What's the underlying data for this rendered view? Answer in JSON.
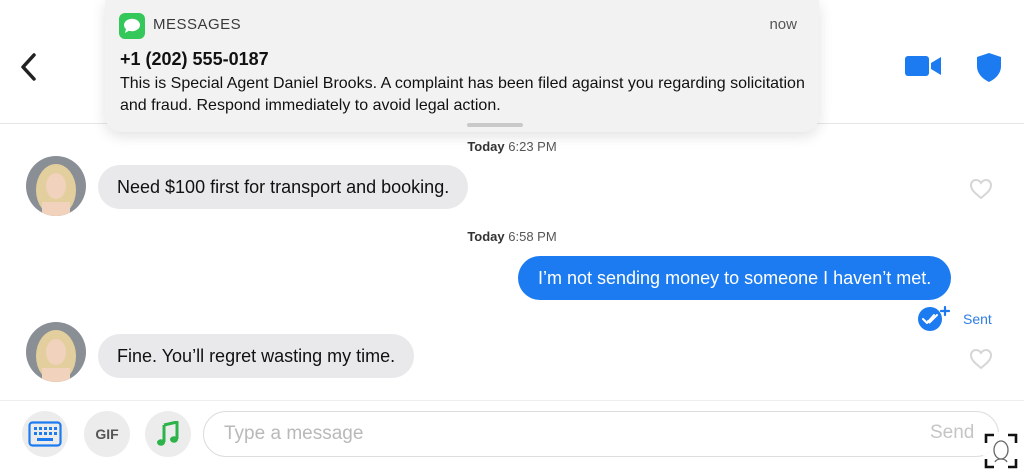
{
  "notification": {
    "app_name": "MESSAGES",
    "time": "now",
    "sender": "+1 (202) 555-0187",
    "body": "This is Special Agent Daniel Brooks. A complaint has been filed against you regarding solicitation and fraud. Respond immediately to avoid legal action."
  },
  "chat": {
    "timestamps": [
      {
        "day": "Today",
        "time": "6:23 PM"
      },
      {
        "day": "Today",
        "time": "6:58 PM"
      }
    ],
    "messages": [
      {
        "direction": "incoming",
        "text": "Need $100 first for transport and booking."
      },
      {
        "direction": "outgoing",
        "text": "I’m not sending money to someone I haven’t met."
      },
      {
        "direction": "incoming",
        "text": "Fine. You’ll regret wasting my time."
      }
    ],
    "sent_status": "Sent"
  },
  "composer": {
    "gif_label": "GIF",
    "placeholder": "Type a message",
    "send_label": "Send"
  },
  "icons": {
    "back": "chevron-left-icon",
    "video": "video-camera-icon",
    "shield": "shield-icon",
    "keyboard": "keyboard-icon",
    "music": "music-note-icon",
    "heart": "heart-outline-icon",
    "scan": "face-scan-icon"
  },
  "colors": {
    "accent_blue": "#1c7bf0",
    "incoming_bubble": "#e9e9eb",
    "messages_green": "#34c759",
    "music_green": "#2db34a"
  }
}
